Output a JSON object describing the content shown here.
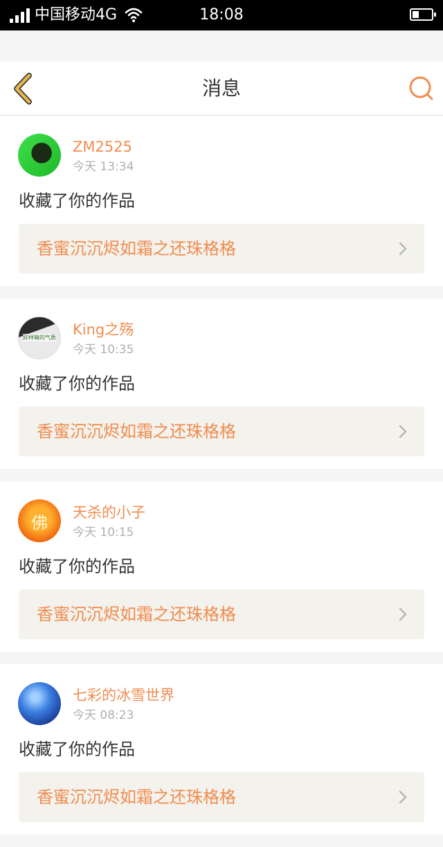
{
  "status_bar": {
    "carrier": "中国移动4G",
    "time": "18:08"
  },
  "header": {
    "title": "消息"
  },
  "messages": [
    {
      "user": "ZM2525",
      "time": "今天 13:34",
      "action": "收藏了你的作品",
      "work": "香蜜沉沉烬如霜之还珠格格"
    },
    {
      "user": "King之殇",
      "time": "今天 10:35",
      "action": "收藏了你的作品",
      "work": "香蜜沉沉烬如霜之还珠格格",
      "avatar_text": "好样嘛的气质"
    },
    {
      "user": "天杀的小子",
      "time": "今天 10:15",
      "action": "收藏了你的作品",
      "work": "香蜜沉沉烬如霜之还珠格格",
      "avatar_text": "佛"
    },
    {
      "user": "七彩的冰雪世界",
      "time": "今天 08:23",
      "action": "收藏了你的作品",
      "work": "香蜜沉沉烬如霜之还珠格格"
    }
  ],
  "colors": {
    "accent": "#f08c50",
    "back_icon": "#e8b84a",
    "work_bg": "#f3f2ec"
  }
}
